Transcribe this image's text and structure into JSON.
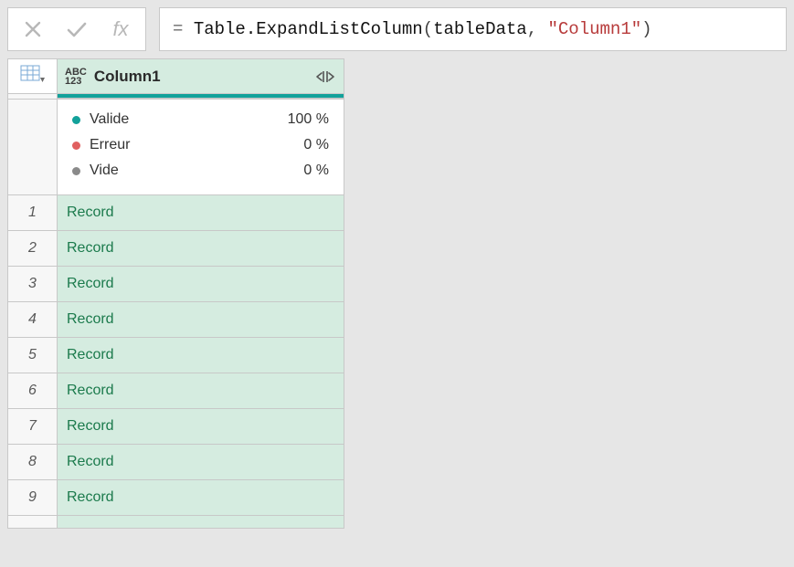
{
  "formula": {
    "eq": "=",
    "func": "Table.ExpandListColumn",
    "arg1": "tableData",
    "arg2": "\"Column1\""
  },
  "column": {
    "type_abc": "ABC",
    "type_123": "123",
    "name": "Column1"
  },
  "quality": {
    "valid_label": "Valide",
    "valid_pct": "100 %",
    "error_label": "Erreur",
    "error_pct": "0 %",
    "empty_label": "Vide",
    "empty_pct": "0 %"
  },
  "rows": [
    {
      "idx": "1",
      "val": "Record"
    },
    {
      "idx": "2",
      "val": "Record"
    },
    {
      "idx": "3",
      "val": "Record"
    },
    {
      "idx": "4",
      "val": "Record"
    },
    {
      "idx": "5",
      "val": "Record"
    },
    {
      "idx": "6",
      "val": "Record"
    },
    {
      "idx": "7",
      "val": "Record"
    },
    {
      "idx": "8",
      "val": "Record"
    },
    {
      "idx": "9",
      "val": "Record"
    }
  ]
}
